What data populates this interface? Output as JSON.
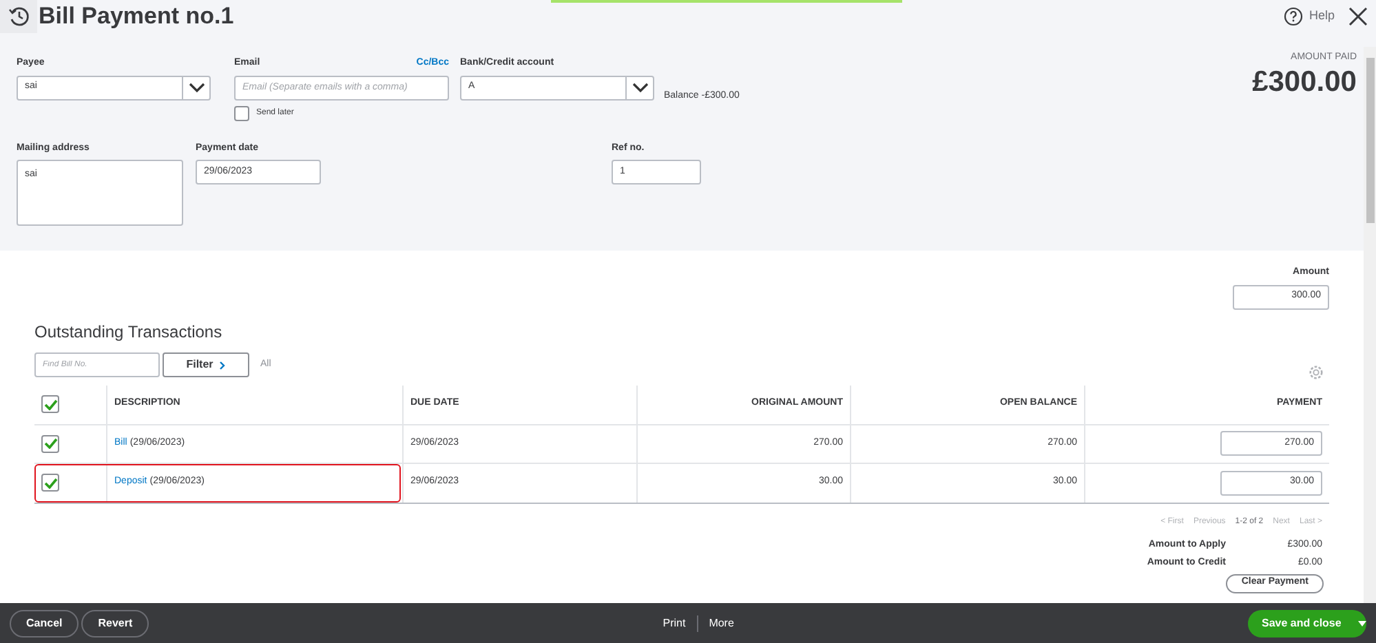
{
  "header": {
    "title": "Bill Payment no.1",
    "help": "Help"
  },
  "form": {
    "payee": {
      "label": "Payee",
      "value": "sai"
    },
    "email": {
      "label": "Email",
      "cc_bcc": "Cc/Bcc",
      "placeholder": "Email (Separate emails with a comma)",
      "send_later": {
        "label": "Send later",
        "checked": false
      }
    },
    "bank_account": {
      "label": "Bank/Credit account",
      "value": "A"
    },
    "balance": "Balance -£300.00",
    "amount_paid": {
      "label": "AMOUNT PAID",
      "value": "£300.00"
    },
    "mailing_address": {
      "label": "Mailing address",
      "value": "sai"
    },
    "payment_date": {
      "label": "Payment date",
      "value": "29/06/2023"
    },
    "ref_no": {
      "label": "Ref no.",
      "value": "1"
    }
  },
  "amount": {
    "label": "Amount",
    "value": "300.00"
  },
  "transactions": {
    "title": "Outstanding Transactions",
    "search_placeholder": "Find Bill No.",
    "filter": "Filter",
    "filter_value": "All",
    "columns": [
      "DESCRIPTION",
      "DUE DATE",
      "ORIGINAL AMOUNT",
      "OPEN BALANCE",
      "PAYMENT"
    ],
    "all_checked": true,
    "rows": [
      {
        "checked": true,
        "highlighted": false,
        "link": "Bill",
        "date": "(29/06/2023)",
        "due_date": "29/06/2023",
        "original_amount": "270.00",
        "open_balance": "270.00",
        "payment": "270.00"
      },
      {
        "checked": true,
        "highlighted": true,
        "link": "Deposit",
        "date": "(29/06/2023)",
        "due_date": "29/06/2023",
        "original_amount": "30.00",
        "open_balance": "30.00",
        "payment": "30.00"
      }
    ],
    "pagination": {
      "first": "< First",
      "previous": "Previous",
      "range": "1-2 of 2",
      "next": "Next",
      "last": "Last >"
    }
  },
  "totals": [
    {
      "label": "Amount to Apply",
      "value": "£300.00"
    },
    {
      "label": "Amount to Credit",
      "value": "£0.00"
    }
  ],
  "clear_payment": "Clear Payment",
  "footer": {
    "cancel": "Cancel",
    "revert": "Revert",
    "print": "Print",
    "more": "More",
    "save": "Save and close"
  }
}
